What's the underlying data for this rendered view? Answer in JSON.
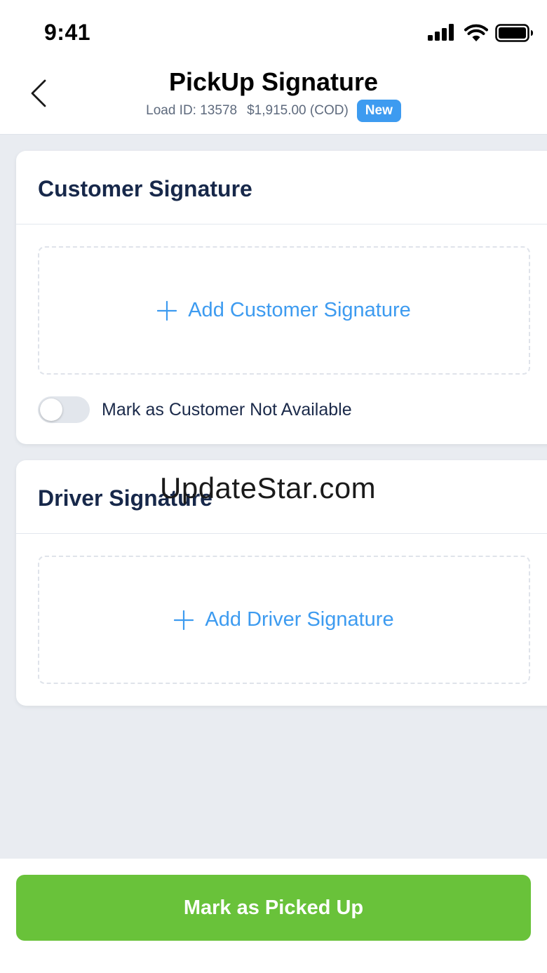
{
  "status_bar": {
    "time": "9:41"
  },
  "header": {
    "title": "PickUp Signature",
    "load_id": "Load ID: 13578",
    "amount": "$1,915.00 (COD)",
    "badge": "New"
  },
  "customer_card": {
    "title": "Customer Signature",
    "add_label": "Add Customer Signature",
    "toggle_label": "Mark as Customer Not Available",
    "toggle_on": false
  },
  "driver_card": {
    "title": "Driver Signature",
    "add_label": "Add Driver Signature"
  },
  "watermark": "UpdateStar.com",
  "footer": {
    "primary_label": "Mark as Picked Up"
  },
  "colors": {
    "accent": "#3d9bf0",
    "primary_button": "#69c23a",
    "title_text": "#17284a",
    "background": "#e9ecf1"
  }
}
